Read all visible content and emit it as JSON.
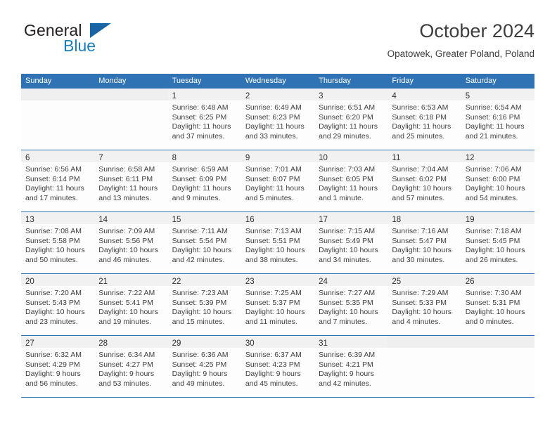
{
  "brand": {
    "name_top": "General",
    "name_bottom": "Blue",
    "accent_color": "#1763a4",
    "blue_text_color": "#1a7fc1",
    "triangle_icon": "triangle-icon"
  },
  "header": {
    "title": "October 2024",
    "subtitle": "Opatowek, Greater Poland, Poland"
  },
  "calendar": {
    "header_bg": "#3073b5",
    "daynum_band_bg": "#f1f1f1",
    "weekdays": [
      "Sunday",
      "Monday",
      "Tuesday",
      "Wednesday",
      "Thursday",
      "Friday",
      "Saturday"
    ],
    "weeks": [
      [
        {
          "day": "",
          "empty": true,
          "sunrise": "",
          "sunset": "",
          "daylight_1": "",
          "daylight_2": ""
        },
        {
          "day": "",
          "empty": true,
          "sunrise": "",
          "sunset": "",
          "daylight_1": "",
          "daylight_2": ""
        },
        {
          "day": "1",
          "empty": false,
          "sunrise": "Sunrise: 6:48 AM",
          "sunset": "Sunset: 6:25 PM",
          "daylight_1": "Daylight: 11 hours",
          "daylight_2": "and 37 minutes."
        },
        {
          "day": "2",
          "empty": false,
          "sunrise": "Sunrise: 6:49 AM",
          "sunset": "Sunset: 6:23 PM",
          "daylight_1": "Daylight: 11 hours",
          "daylight_2": "and 33 minutes."
        },
        {
          "day": "3",
          "empty": false,
          "sunrise": "Sunrise: 6:51 AM",
          "sunset": "Sunset: 6:20 PM",
          "daylight_1": "Daylight: 11 hours",
          "daylight_2": "and 29 minutes."
        },
        {
          "day": "4",
          "empty": false,
          "sunrise": "Sunrise: 6:53 AM",
          "sunset": "Sunset: 6:18 PM",
          "daylight_1": "Daylight: 11 hours",
          "daylight_2": "and 25 minutes."
        },
        {
          "day": "5",
          "empty": false,
          "sunrise": "Sunrise: 6:54 AM",
          "sunset": "Sunset: 6:16 PM",
          "daylight_1": "Daylight: 11 hours",
          "daylight_2": "and 21 minutes."
        }
      ],
      [
        {
          "day": "6",
          "empty": false,
          "sunrise": "Sunrise: 6:56 AM",
          "sunset": "Sunset: 6:14 PM",
          "daylight_1": "Daylight: 11 hours",
          "daylight_2": "and 17 minutes."
        },
        {
          "day": "7",
          "empty": false,
          "sunrise": "Sunrise: 6:58 AM",
          "sunset": "Sunset: 6:11 PM",
          "daylight_1": "Daylight: 11 hours",
          "daylight_2": "and 13 minutes."
        },
        {
          "day": "8",
          "empty": false,
          "sunrise": "Sunrise: 6:59 AM",
          "sunset": "Sunset: 6:09 PM",
          "daylight_1": "Daylight: 11 hours",
          "daylight_2": "and 9 minutes."
        },
        {
          "day": "9",
          "empty": false,
          "sunrise": "Sunrise: 7:01 AM",
          "sunset": "Sunset: 6:07 PM",
          "daylight_1": "Daylight: 11 hours",
          "daylight_2": "and 5 minutes."
        },
        {
          "day": "10",
          "empty": false,
          "sunrise": "Sunrise: 7:03 AM",
          "sunset": "Sunset: 6:05 PM",
          "daylight_1": "Daylight: 11 hours",
          "daylight_2": "and 1 minute."
        },
        {
          "day": "11",
          "empty": false,
          "sunrise": "Sunrise: 7:04 AM",
          "sunset": "Sunset: 6:02 PM",
          "daylight_1": "Daylight: 10 hours",
          "daylight_2": "and 57 minutes."
        },
        {
          "day": "12",
          "empty": false,
          "sunrise": "Sunrise: 7:06 AM",
          "sunset": "Sunset: 6:00 PM",
          "daylight_1": "Daylight: 10 hours",
          "daylight_2": "and 54 minutes."
        }
      ],
      [
        {
          "day": "13",
          "empty": false,
          "sunrise": "Sunrise: 7:08 AM",
          "sunset": "Sunset: 5:58 PM",
          "daylight_1": "Daylight: 10 hours",
          "daylight_2": "and 50 minutes."
        },
        {
          "day": "14",
          "empty": false,
          "sunrise": "Sunrise: 7:09 AM",
          "sunset": "Sunset: 5:56 PM",
          "daylight_1": "Daylight: 10 hours",
          "daylight_2": "and 46 minutes."
        },
        {
          "day": "15",
          "empty": false,
          "sunrise": "Sunrise: 7:11 AM",
          "sunset": "Sunset: 5:54 PM",
          "daylight_1": "Daylight: 10 hours",
          "daylight_2": "and 42 minutes."
        },
        {
          "day": "16",
          "empty": false,
          "sunrise": "Sunrise: 7:13 AM",
          "sunset": "Sunset: 5:51 PM",
          "daylight_1": "Daylight: 10 hours",
          "daylight_2": "and 38 minutes."
        },
        {
          "day": "17",
          "empty": false,
          "sunrise": "Sunrise: 7:15 AM",
          "sunset": "Sunset: 5:49 PM",
          "daylight_1": "Daylight: 10 hours",
          "daylight_2": "and 34 minutes."
        },
        {
          "day": "18",
          "empty": false,
          "sunrise": "Sunrise: 7:16 AM",
          "sunset": "Sunset: 5:47 PM",
          "daylight_1": "Daylight: 10 hours",
          "daylight_2": "and 30 minutes."
        },
        {
          "day": "19",
          "empty": false,
          "sunrise": "Sunrise: 7:18 AM",
          "sunset": "Sunset: 5:45 PM",
          "daylight_1": "Daylight: 10 hours",
          "daylight_2": "and 26 minutes."
        }
      ],
      [
        {
          "day": "20",
          "empty": false,
          "sunrise": "Sunrise: 7:20 AM",
          "sunset": "Sunset: 5:43 PM",
          "daylight_1": "Daylight: 10 hours",
          "daylight_2": "and 23 minutes."
        },
        {
          "day": "21",
          "empty": false,
          "sunrise": "Sunrise: 7:22 AM",
          "sunset": "Sunset: 5:41 PM",
          "daylight_1": "Daylight: 10 hours",
          "daylight_2": "and 19 minutes."
        },
        {
          "day": "22",
          "empty": false,
          "sunrise": "Sunrise: 7:23 AM",
          "sunset": "Sunset: 5:39 PM",
          "daylight_1": "Daylight: 10 hours",
          "daylight_2": "and 15 minutes."
        },
        {
          "day": "23",
          "empty": false,
          "sunrise": "Sunrise: 7:25 AM",
          "sunset": "Sunset: 5:37 PM",
          "daylight_1": "Daylight: 10 hours",
          "daylight_2": "and 11 minutes."
        },
        {
          "day": "24",
          "empty": false,
          "sunrise": "Sunrise: 7:27 AM",
          "sunset": "Sunset: 5:35 PM",
          "daylight_1": "Daylight: 10 hours",
          "daylight_2": "and 7 minutes."
        },
        {
          "day": "25",
          "empty": false,
          "sunrise": "Sunrise: 7:29 AM",
          "sunset": "Sunset: 5:33 PM",
          "daylight_1": "Daylight: 10 hours",
          "daylight_2": "and 4 minutes."
        },
        {
          "day": "26",
          "empty": false,
          "sunrise": "Sunrise: 7:30 AM",
          "sunset": "Sunset: 5:31 PM",
          "daylight_1": "Daylight: 10 hours",
          "daylight_2": "and 0 minutes."
        }
      ],
      [
        {
          "day": "27",
          "empty": false,
          "sunrise": "Sunrise: 6:32 AM",
          "sunset": "Sunset: 4:29 PM",
          "daylight_1": "Daylight: 9 hours",
          "daylight_2": "and 56 minutes."
        },
        {
          "day": "28",
          "empty": false,
          "sunrise": "Sunrise: 6:34 AM",
          "sunset": "Sunset: 4:27 PM",
          "daylight_1": "Daylight: 9 hours",
          "daylight_2": "and 53 minutes."
        },
        {
          "day": "29",
          "empty": false,
          "sunrise": "Sunrise: 6:36 AM",
          "sunset": "Sunset: 4:25 PM",
          "daylight_1": "Daylight: 9 hours",
          "daylight_2": "and 49 minutes."
        },
        {
          "day": "30",
          "empty": false,
          "sunrise": "Sunrise: 6:37 AM",
          "sunset": "Sunset: 4:23 PM",
          "daylight_1": "Daylight: 9 hours",
          "daylight_2": "and 45 minutes."
        },
        {
          "day": "31",
          "empty": false,
          "sunrise": "Sunrise: 6:39 AM",
          "sunset": "Sunset: 4:21 PM",
          "daylight_1": "Daylight: 9 hours",
          "daylight_2": "and 42 minutes."
        },
        {
          "day": "",
          "empty": true,
          "sunrise": "",
          "sunset": "",
          "daylight_1": "",
          "daylight_2": ""
        },
        {
          "day": "",
          "empty": true,
          "sunrise": "",
          "sunset": "",
          "daylight_1": "",
          "daylight_2": ""
        }
      ]
    ]
  }
}
